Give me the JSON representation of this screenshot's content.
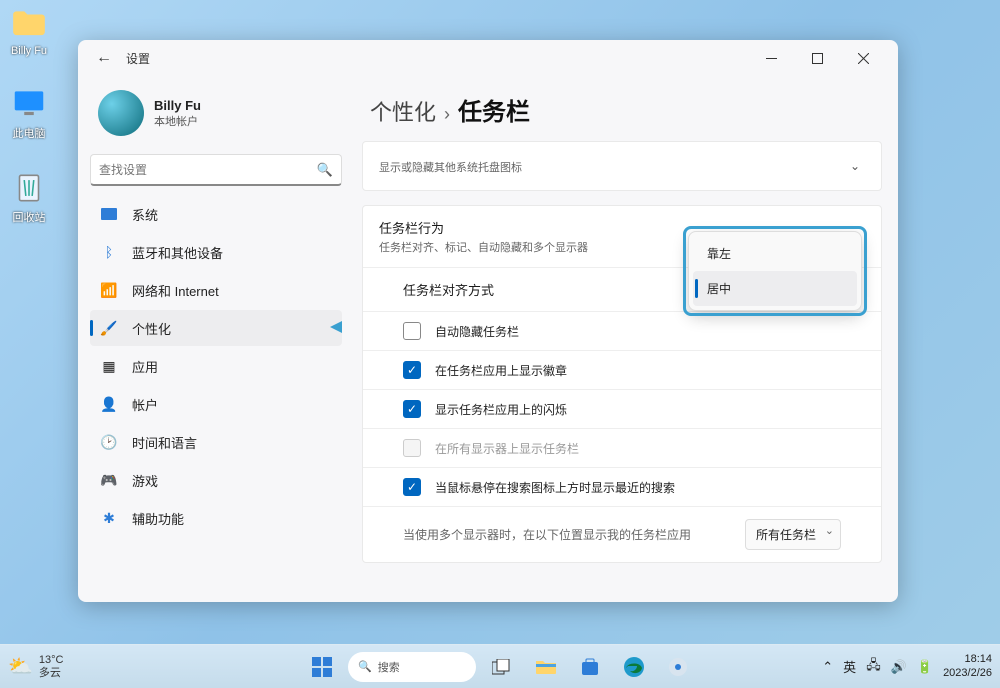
{
  "desktop": [
    {
      "label": "Billy Fu"
    },
    {
      "label": "此电脑"
    },
    {
      "label": "回收站"
    }
  ],
  "window": {
    "title": "设置",
    "user": {
      "name": "Billy Fu",
      "sub": "本地帐户"
    },
    "search": {
      "placeholder": "查找设置"
    },
    "nav": [
      {
        "label": "系统"
      },
      {
        "label": "蓝牙和其他设备"
      },
      {
        "label": "网络和 Internet"
      },
      {
        "label": "个性化"
      },
      {
        "label": "应用"
      },
      {
        "label": "帐户"
      },
      {
        "label": "时间和语言"
      },
      {
        "label": "游戏"
      },
      {
        "label": "辅助功能"
      }
    ],
    "breadcrumb": {
      "parent": "个性化",
      "current": "任务栏"
    },
    "tray_card": {
      "sub": "显示或隐藏其他系统托盘图标"
    },
    "behavior": {
      "title": "任务栏行为",
      "sub": "任务栏对齐、标记、自动隐藏和多个显示器",
      "align_label": "任务栏对齐方式",
      "items": [
        {
          "label": "自动隐藏任务栏",
          "on": false
        },
        {
          "label": "在任务栏应用上显示徽章",
          "on": true
        },
        {
          "label": "显示任务栏应用上的闪烁",
          "on": true
        },
        {
          "label": "在所有显示器上显示任务栏",
          "on": false,
          "disabled": true
        },
        {
          "label": "当鼠标悬停在搜索图标上方时显示最近的搜索",
          "on": true
        }
      ],
      "multi": {
        "text": "当使用多个显示器时，在以下位置显示我的任务栏应用",
        "value": "所有任务栏"
      },
      "popup": [
        "靠左",
        "居中"
      ]
    }
  },
  "taskbar": {
    "weather": {
      "temp": "13°C",
      "cond": "多云"
    },
    "search": "搜索",
    "ime": "英",
    "clock": {
      "time": "18:14",
      "date": "2023/2/26"
    }
  },
  "colors": {
    "accent": "#0067c0",
    "highlight": "#3aa0d0"
  }
}
